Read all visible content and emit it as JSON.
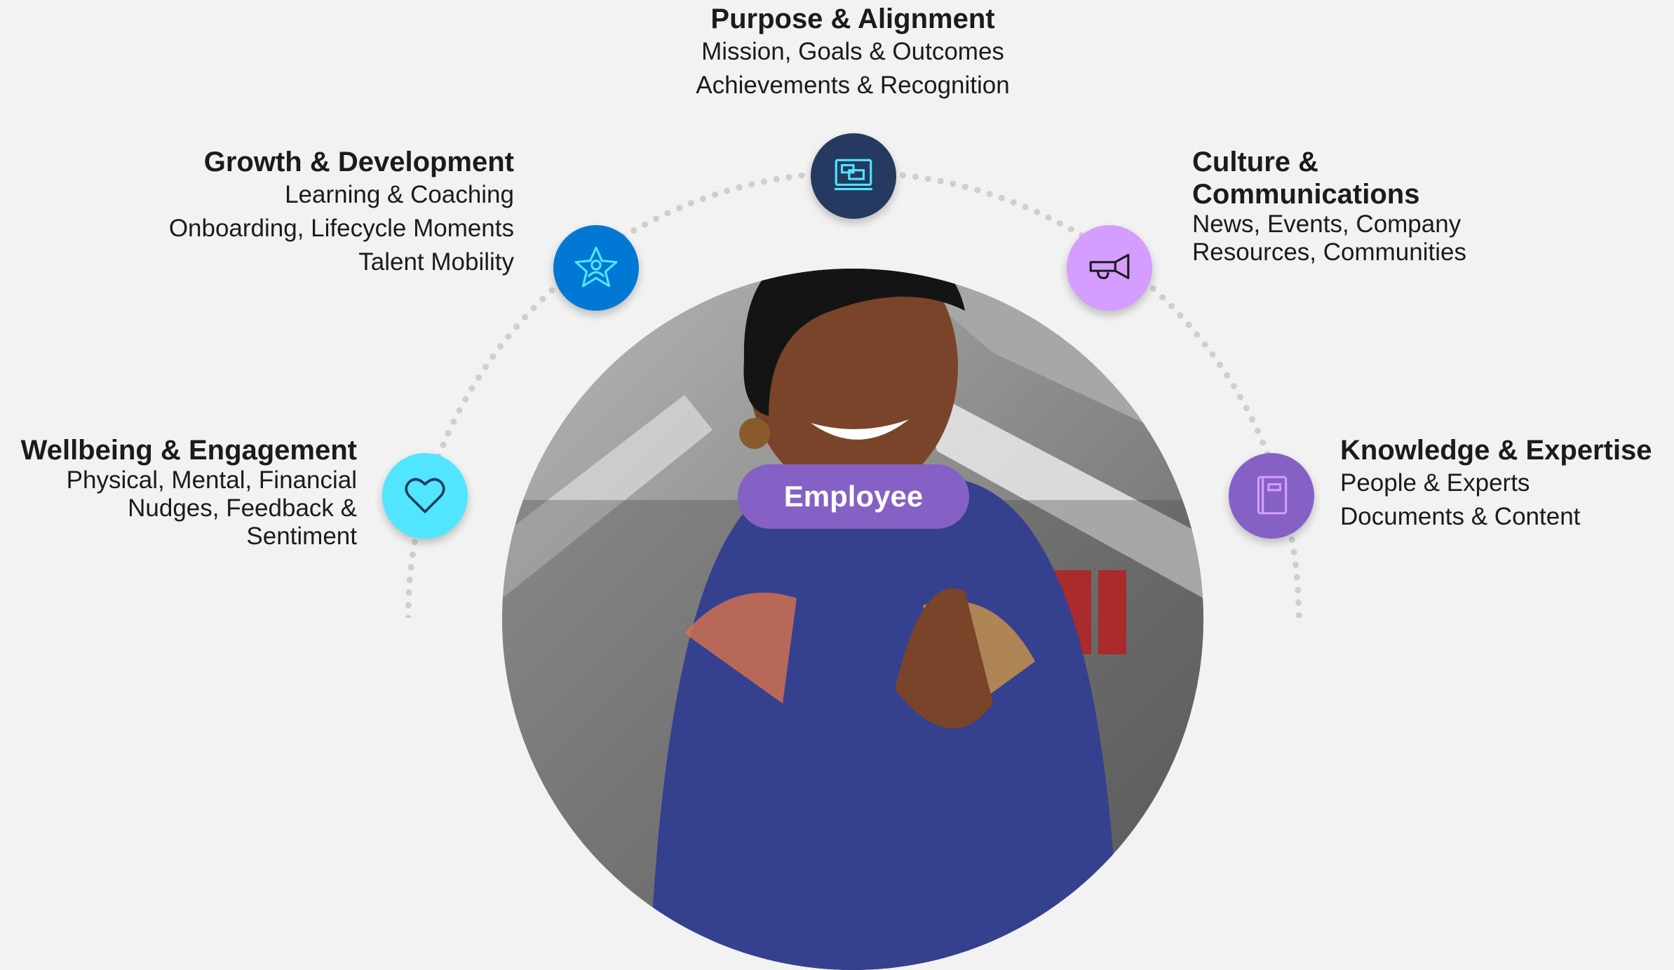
{
  "center": {
    "label": "Employee"
  },
  "colors": {
    "purpose_node": "#243a5e",
    "growth_node": "#0078d4",
    "culture_node": "#d59dff",
    "wellbeing_node": "#50e6ff",
    "knowledge_node": "#8661c5",
    "employee_pill": "#8661c5",
    "arc_dots": "#cfcfcf"
  },
  "categories": {
    "purpose": {
      "icon": "presentation-board-icon",
      "title": "Purpose & Alignment",
      "lines": [
        "Mission, Goals & Outcomes",
        "Achievements & Recognition"
      ]
    },
    "growth": {
      "icon": "star-person-icon",
      "title": "Growth & Development",
      "lines": [
        "Learning & Coaching",
        "Onboarding, Lifecycle Moments",
        "Talent Mobility"
      ]
    },
    "culture": {
      "icon": "megaphone-icon",
      "title_lines": [
        "Culture &",
        "Communications"
      ],
      "lines": [
        "News, Events, Company",
        "Resources, Communities"
      ]
    },
    "wellbeing": {
      "icon": "heart-icon",
      "title": "Wellbeing & Engagement",
      "lines": [
        "Physical, Mental, Financial",
        "Nudges, Feedback &",
        "Sentiment"
      ]
    },
    "knowledge": {
      "icon": "book-icon",
      "title": "Knowledge & Expertise",
      "lines": [
        "People & Experts",
        "Documents & Content"
      ]
    }
  }
}
